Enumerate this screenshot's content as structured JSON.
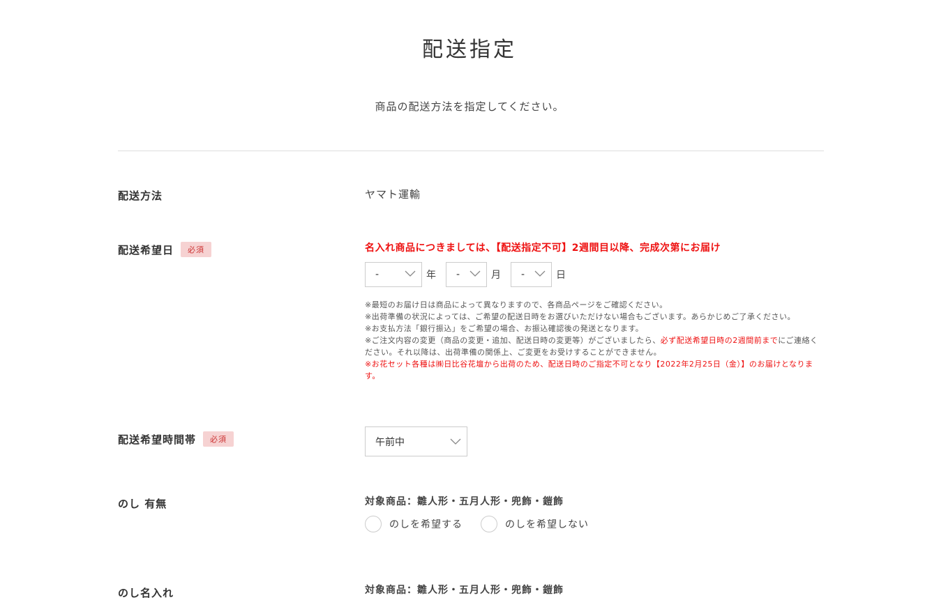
{
  "header": {
    "title": "配送指定",
    "subtitle": "商品の配送方法を指定してください。"
  },
  "fields": {
    "method": {
      "label": "配送方法",
      "value": "ヤマト運輸"
    },
    "date": {
      "label": "配送希望日",
      "required": "必須",
      "notice": "名入れ商品につきましては、【配送指定不可】2週間目以降、完成次第にお届け",
      "year_value": "-",
      "year_unit": "年",
      "month_value": "-",
      "month_unit": "月",
      "day_value": "-",
      "day_unit": "日",
      "notes": [
        "※最短のお届け日は商品によって異なりますので、各商品ページをご確認ください。",
        "※出荷準備の状況によっては、ご希望の配送日時をお選びいただけない場合もございます。あらかじめご了承ください。",
        "※お支払方法「銀行振込」をご希望の場合、お振込確認後の発送となります。"
      ],
      "note4_before": "※ご注文内容の変更（商品の変更・追加、配送日時の変更等）がございましたら、",
      "note4_red": "必ず配送希望日時の2週間前まで",
      "note4_after": "にご連絡ください。それ以降は、出荷準備の関係上、ご変更をお受けすることができません。",
      "note5_red": "※お花セット各種は㈱日比谷花壇から出荷のため、配送日時のご指定不可となり【2022年2月25日（金）】のお届けとなります。"
    },
    "time": {
      "label": "配送希望時間帯",
      "required": "必須",
      "value": "午前中"
    },
    "noshi": {
      "label": "のし 有無",
      "target": "対象商品：雛人形・五月人形・兜飾・鎧飾",
      "option_yes": "のしを希望する",
      "option_no": "のしを希望しない"
    },
    "noshi_name": {
      "label": "のし名入れ",
      "target": "対象商品：雛人形・五月人形・兜飾・鎧飾"
    }
  },
  "colors": {
    "accent_red": "#e11111",
    "badge_bg": "#f6d2d2",
    "border": "#cccccc"
  }
}
